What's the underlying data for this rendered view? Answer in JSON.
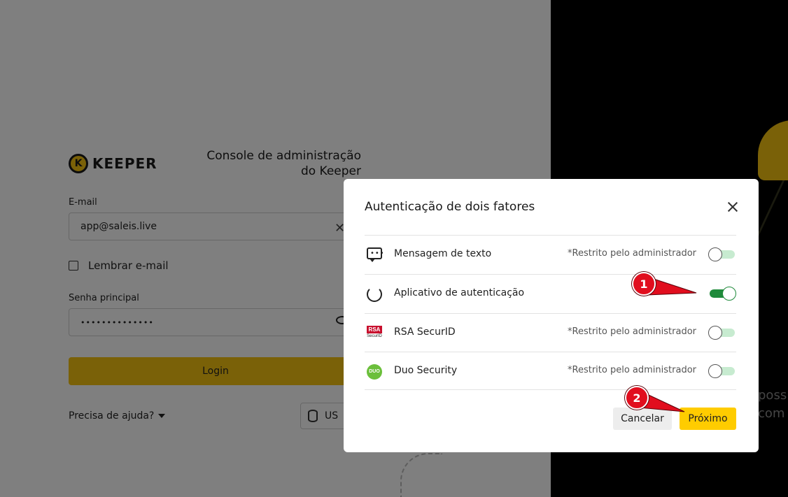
{
  "background": {
    "brand": "KEEPER",
    "console_title": "Console de administração do Keeper",
    "email_label": "E-mail",
    "email_value": "app@saleis.live",
    "remember_label": "Lembrar e-mail",
    "password_label": "Senha principal",
    "password_value": "••••••••••••••",
    "login_label": "Login",
    "help_label": "Precisa de ajuda?",
    "region_label": "US",
    "promo_line_1": "possív",
    "promo_line_2": "com s"
  },
  "modal": {
    "title": "Autenticação de dois fatores",
    "options": [
      {
        "label": "Mensagem de texto",
        "note": "*Restrito pelo administrador",
        "enabled": false,
        "icon": "message-icon"
      },
      {
        "label": "Aplicativo de autenticação",
        "note": "",
        "enabled": true,
        "icon": "authenticator-app-icon"
      },
      {
        "label": "RSA SecurID",
        "note": "*Restrito pelo administrador",
        "enabled": false,
        "icon": "rsa-securid-icon"
      },
      {
        "label": "Duo Security",
        "note": "*Restrito pelo administrador",
        "enabled": false,
        "icon": "duo-security-icon"
      }
    ],
    "rsa_icon_top": "RSA",
    "rsa_icon_sub": "SecurID",
    "duo_icon_text": "DUO",
    "cancel_label": "Cancelar",
    "next_label": "Próximo"
  },
  "annotations": {
    "step_1": "1",
    "step_2": "2"
  },
  "colors": {
    "brand_yellow": "#f5c211",
    "next_button": "#ffcc00",
    "toggle_on": "#1f8a3b",
    "toggle_off_track": "#c7ebd0",
    "callout_red": "#e10e1e"
  }
}
